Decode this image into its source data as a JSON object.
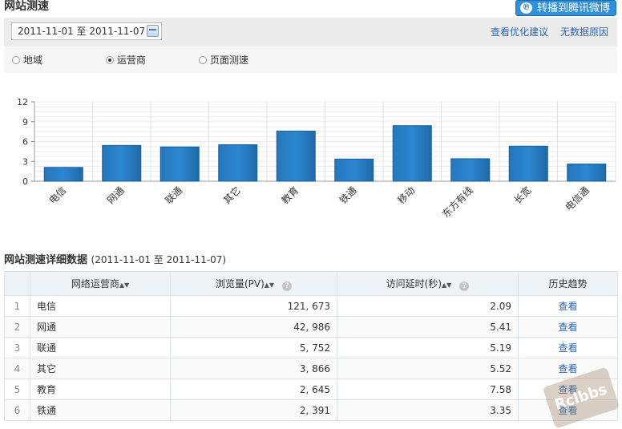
{
  "header": {
    "title": "网站测速",
    "share_label": "转播到腾讯微博",
    "share_icon_text": "℗"
  },
  "toolbar": {
    "date_range": "2011-11-01 至 2011-11-07",
    "optimize_link": "查看优化建议",
    "nodata_link": "无数据原因"
  },
  "radios": [
    {
      "label": "地域",
      "selected": false
    },
    {
      "label": "运营商",
      "selected": true
    },
    {
      "label": "页面测速",
      "selected": false
    }
  ],
  "chart_data": {
    "type": "bar",
    "categories": [
      "电信",
      "网通",
      "联通",
      "其它",
      "教育",
      "铁通",
      "移动",
      "东方有线",
      "长宽",
      "电信通"
    ],
    "values": [
      2.09,
      5.41,
      5.19,
      5.52,
      7.58,
      3.35,
      8.4,
      3.4,
      5.3,
      2.6
    ],
    "ylim": [
      0,
      12
    ],
    "yticks": [
      0,
      3,
      6,
      9,
      12
    ],
    "color": "#2e86d0",
    "grid": true
  },
  "detail": {
    "title": "网站测速详细数据",
    "range": "(2011-11-01 至 2011-11-07)",
    "columns": [
      "网络运营商",
      "浏览量(PV)",
      "访问延时(秒)",
      "历史趋势"
    ],
    "rows": [
      {
        "idx": "1",
        "name": "电信",
        "pv": "121, 673",
        "delay": "2.09",
        "trend": "查看"
      },
      {
        "idx": "2",
        "name": "网通",
        "pv": "42, 986",
        "delay": "5.41",
        "trend": "查看"
      },
      {
        "idx": "3",
        "name": "联通",
        "pv": "5, 752",
        "delay": "5.19",
        "trend": "查看"
      },
      {
        "idx": "4",
        "name": "其它",
        "pv": "3, 866",
        "delay": "5.52",
        "trend": "查看"
      },
      {
        "idx": "5",
        "name": "教育",
        "pv": "2, 645",
        "delay": "7.58",
        "trend": "查看"
      },
      {
        "idx": "6",
        "name": "铁通",
        "pv": "2, 391",
        "delay": "3.35",
        "trend": "查看"
      }
    ]
  },
  "watermark": "Rclbbs"
}
